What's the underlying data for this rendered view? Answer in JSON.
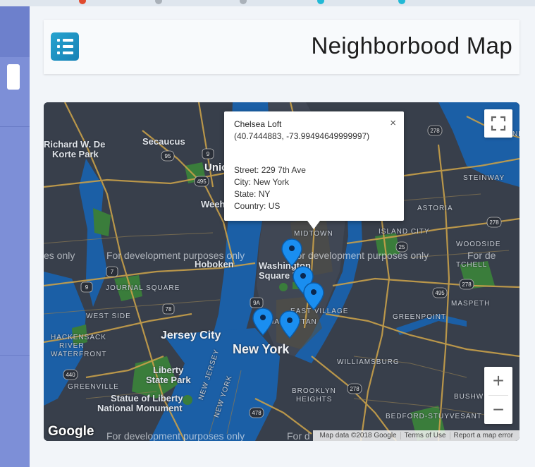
{
  "header": {
    "title": "Neighborbood Map",
    "menu_icon": "list-icon"
  },
  "info_window": {
    "place": "Chelsea Loft",
    "coords": "(40.7444883, -73.99494649999997)",
    "street_label": "Street:",
    "street": "229 7th Ave",
    "city_label": "City:",
    "city": "New York",
    "state_label": "State:",
    "state": "NY",
    "country_label": "Country:",
    "country": "US",
    "close": "×"
  },
  "map": {
    "dev_notice": "For development purposes only",
    "dev_notice_left": "es only",
    "dev_notice_right": "For de",
    "dev_notice_edge": "For d",
    "labels": {
      "richard": "Richard W. De",
      "korte": "Korte Park",
      "secaucus": "Secaucus",
      "union": "Unio",
      "weeh": "Weeh",
      "hoboken": "Hoboken",
      "washington": "Washington",
      "square": "Square P",
      "journal": "JOURNAL SQUARE",
      "west_side": "WEST SIDE",
      "hackensack": "HACKENSACK",
      "river_wf": "RIVER",
      "waterfront": "WATERFRONT",
      "jersey_city": "Jersey City",
      "new_york": "New York",
      "liberty": "Liberty",
      "state_park": "State Park",
      "greenville": "GREENVILLE",
      "statue": "Statue of Liberty",
      "national": "National Monument",
      "new_jersey": "NEW JERSEY",
      "new_york_rot": "NEW YORK",
      "midtown": "MIDTOWN",
      "east_village": "EAST VILLAGE",
      "manhattan": "MANHATTAN",
      "island_city": "ISLAND CITY",
      "mitchell": "TCHELL",
      "astoria": "ASTORIA",
      "steinway": "STEINWAY",
      "woodside": "WOODSIDE",
      "greenpoint": "GREENPOINT",
      "maspeth": "MASPETH",
      "williamsburg": "WILLIAMSBURG",
      "brooklyn_navy": "BROOKLYN",
      "heights": "HEIGHTS",
      "bedford": "BEDFORD-STUYVESANT",
      "bushwick": "BUSHWICK",
      "ny_east": "NE"
    },
    "route_shields": [
      "95",
      "9",
      "495",
      "7",
      "9",
      "78",
      "9A",
      "440",
      "25",
      "495",
      "278",
      "278",
      "278",
      "278",
      "478"
    ],
    "attribution": {
      "map_data": "Map data ©2018 Google",
      "terms": "Terms of Use",
      "report": "Report a map error"
    },
    "google": "Google",
    "zoom_in": "+",
    "zoom_out": "−",
    "colors": {
      "land": "#343b47",
      "water": "#1b5fa6",
      "park": "#3a7d3b",
      "road": "#c8a04a",
      "marker": "#1a8ef0"
    }
  }
}
